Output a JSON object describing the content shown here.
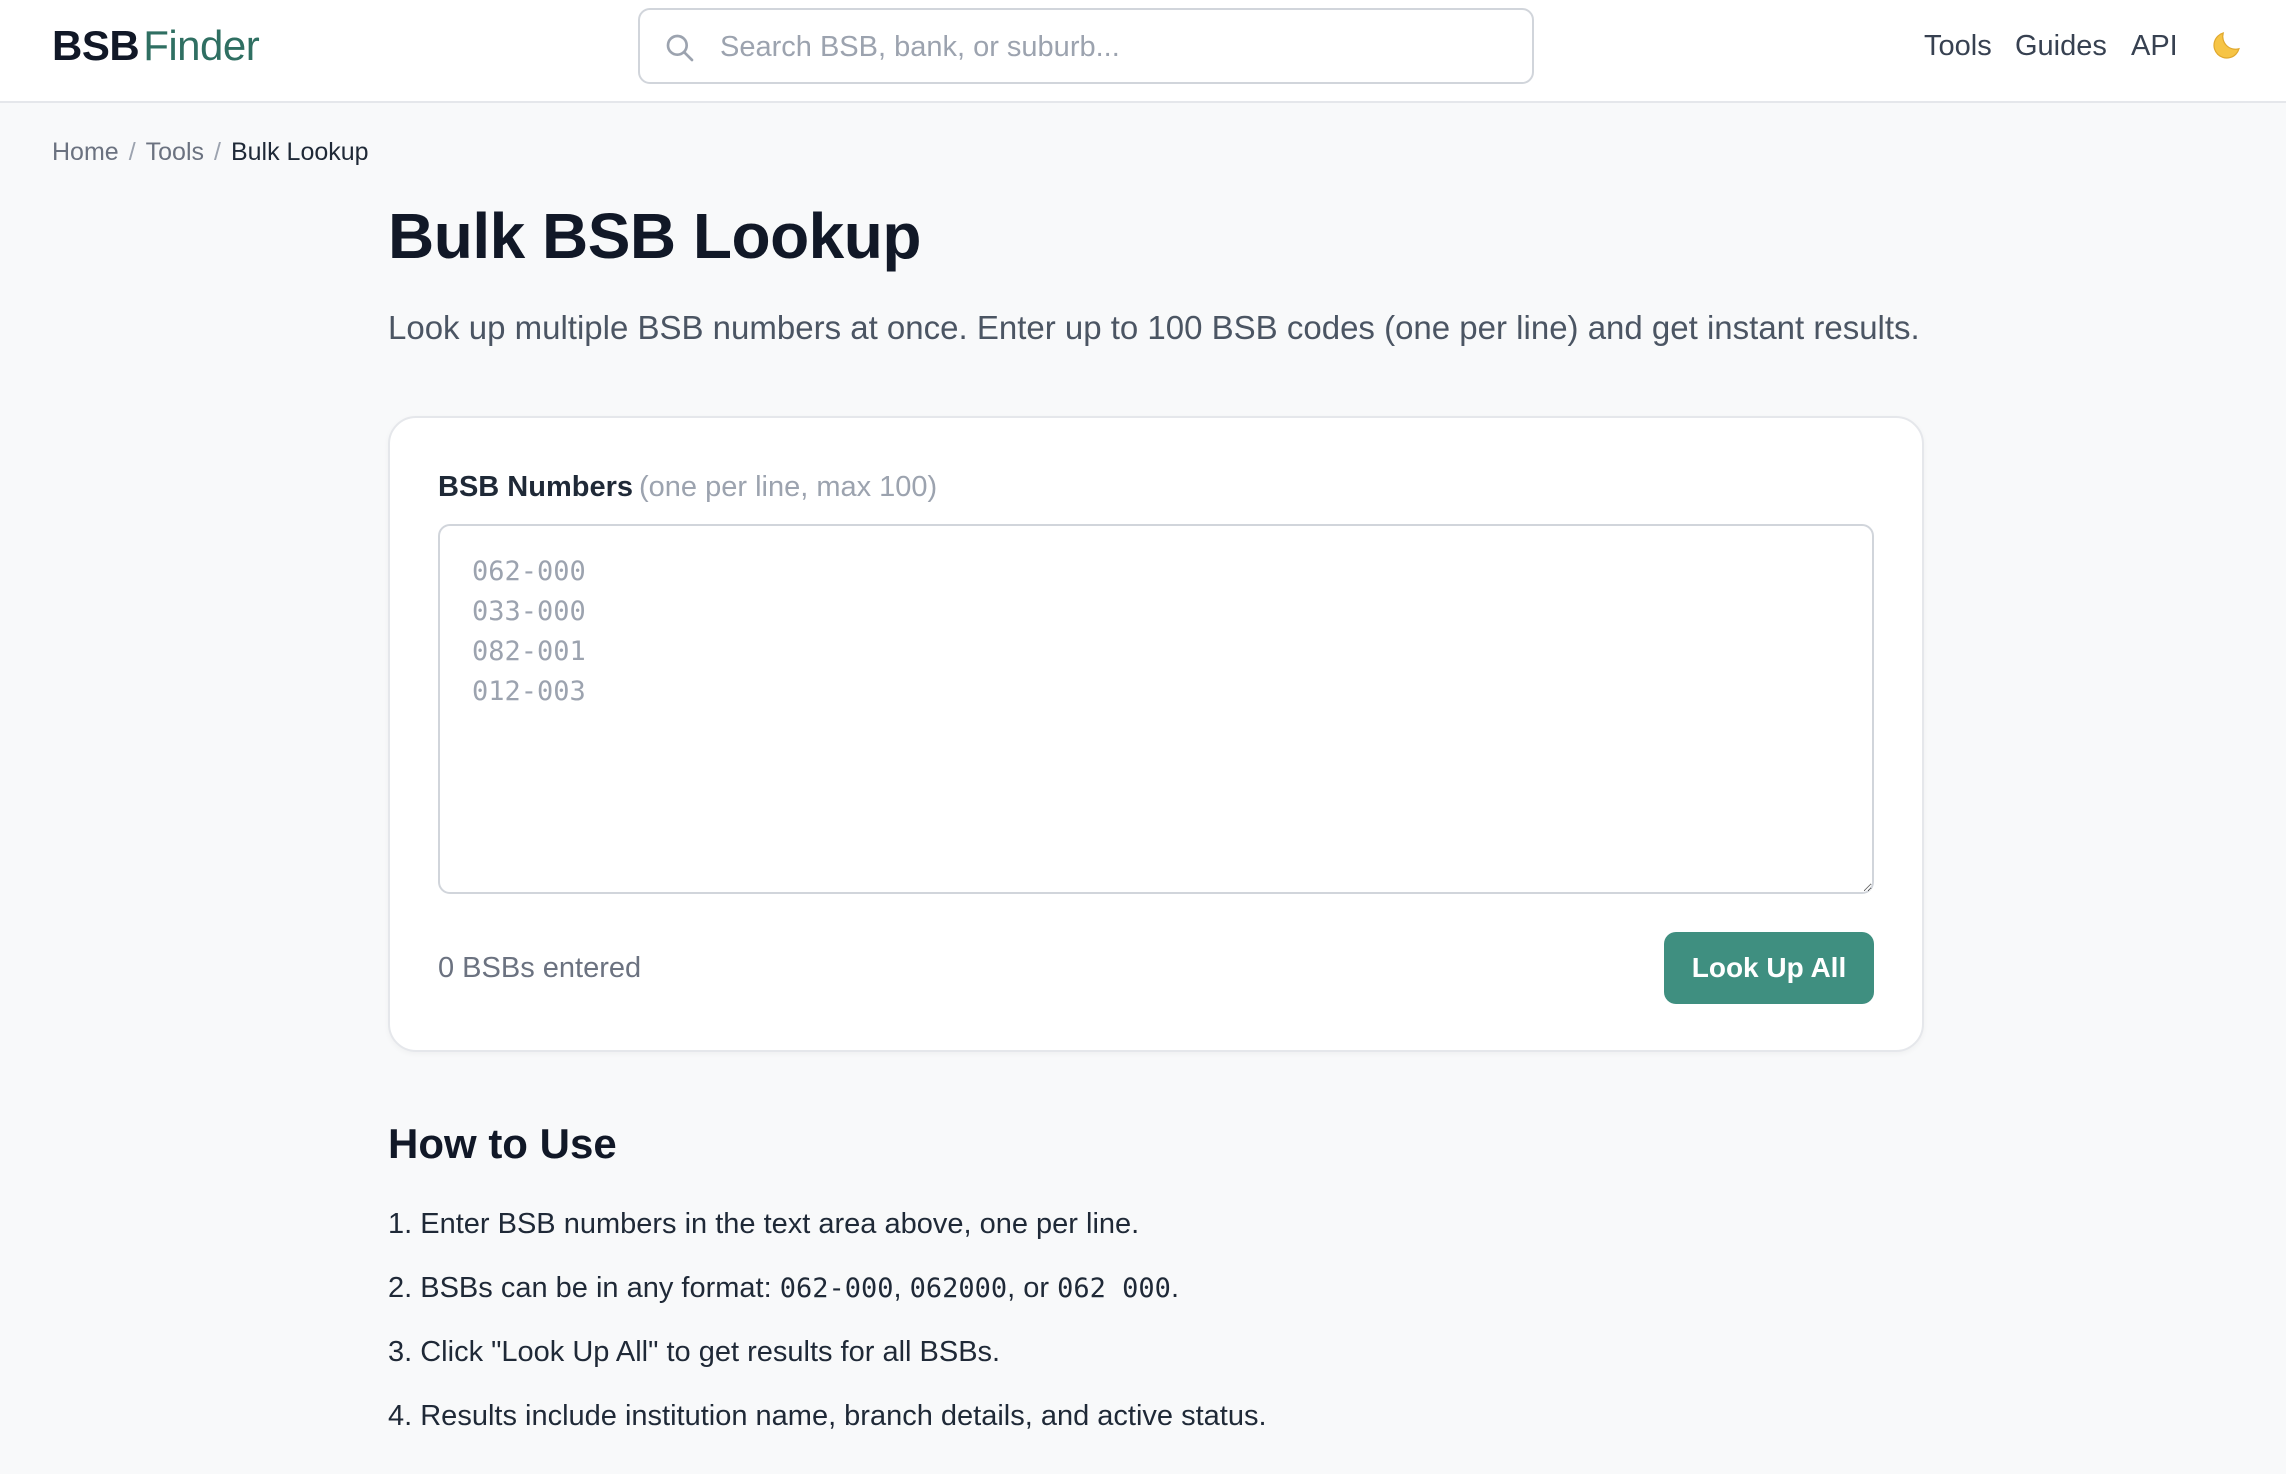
{
  "header": {
    "logo_bold": "BSB",
    "logo_light": "Finder",
    "search_placeholder": "Search BSB, bank, or suburb...",
    "nav": {
      "tools": "Tools",
      "guides": "Guides",
      "api": "API"
    },
    "theme_toggle_icon": "moon-icon"
  },
  "breadcrumb": {
    "home": "Home",
    "tools": "Tools",
    "current": "Bulk Lookup",
    "separator": "/"
  },
  "page": {
    "title": "Bulk BSB Lookup",
    "subtitle": "Look up multiple BSB numbers at once. Enter up to 100 BSB codes (one per line) and get instant results."
  },
  "form": {
    "label": "BSB Numbers",
    "label_hint": "(one per line, max 100)",
    "textarea_value": "",
    "textarea_placeholder": "062-000\n033-000\n082-001\n012-003",
    "count_text": "0 BSBs entered",
    "submit_label": "Look Up All"
  },
  "how_to_use": {
    "heading": "How to Use",
    "step1": "1. Enter BSB numbers in the text area above, one per line.",
    "step2_prefix": "2. BSBs can be in any format: ",
    "step2_code1": "062-000",
    "step2_sep1": ", ",
    "step2_code2": "062000",
    "step2_sep2": ", or ",
    "step2_code3": "062 000",
    "step2_suffix": ".",
    "step3": "3. Click \"Look Up All\" to get results for all BSBs.",
    "step4": "4. Results include institution name, branch details, and active status."
  },
  "colors": {
    "accent": "#3f8f80",
    "logo_accent": "#2f6f62",
    "background": "#f8f9fa"
  }
}
